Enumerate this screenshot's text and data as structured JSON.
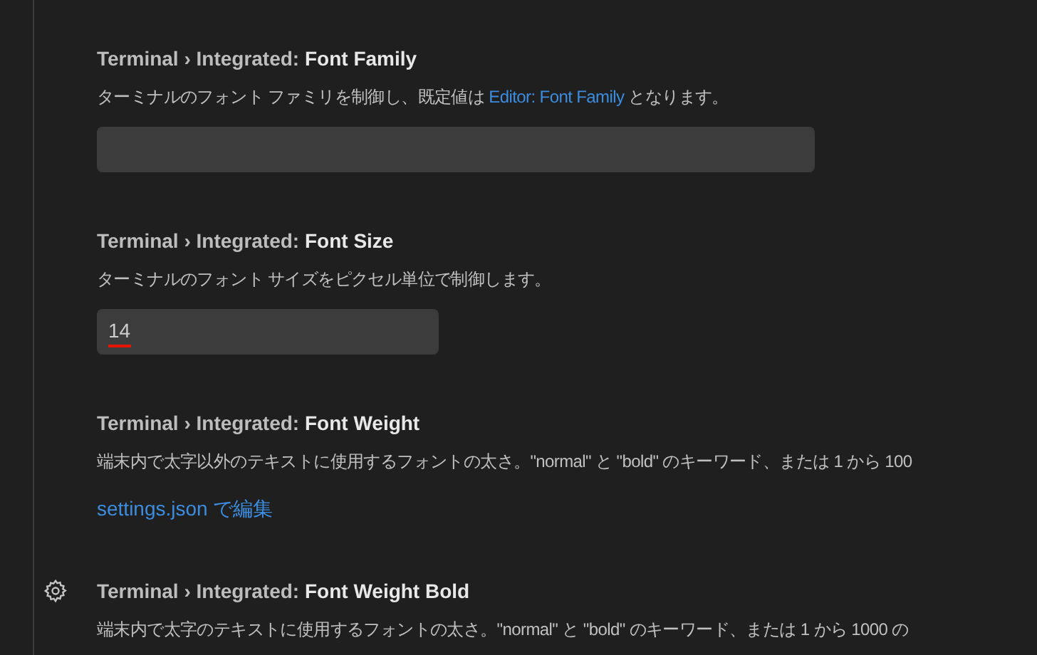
{
  "settings": [
    {
      "category": "Terminal › Integrated: ",
      "name": "Font Family",
      "hovered": false,
      "description": [
        {
          "text": "ターミナルのフォント ファミリを制御し、既定値は ",
          "link": false
        },
        {
          "text": "Editor: Font Family",
          "link": true
        },
        {
          "text": " となります。",
          "link": false
        }
      ],
      "control": {
        "kind": "text"
      }
    },
    {
      "category": "Terminal › Integrated: ",
      "name": "Font Size",
      "hovered": false,
      "description": [
        {
          "text": "ターミナルのフォント サイズをピクセル単位で制御します。",
          "link": false
        }
      ],
      "control": {
        "kind": "number",
        "value": "14",
        "underlined": true
      }
    },
    {
      "category": "Terminal › Integrated: ",
      "name": "Font Weight",
      "hovered": false,
      "description": [
        {
          "text": "端末内で太字以外のテキストに使用するフォントの太さ。\"normal\" と \"bold\" のキーワード、または 1 から 100",
          "link": false
        }
      ],
      "control": {
        "kind": "link",
        "label": "settings.json で編集"
      }
    },
    {
      "category": "Terminal › Integrated: ",
      "name": "Font Weight Bold",
      "hovered": true,
      "description": [
        {
          "text": "端末内で太字のテキストに使用するフォントの太さ。\"normal\" と \"bold\" のキーワード、または 1 から 1000 の",
          "link": false
        }
      ]
    }
  ]
}
